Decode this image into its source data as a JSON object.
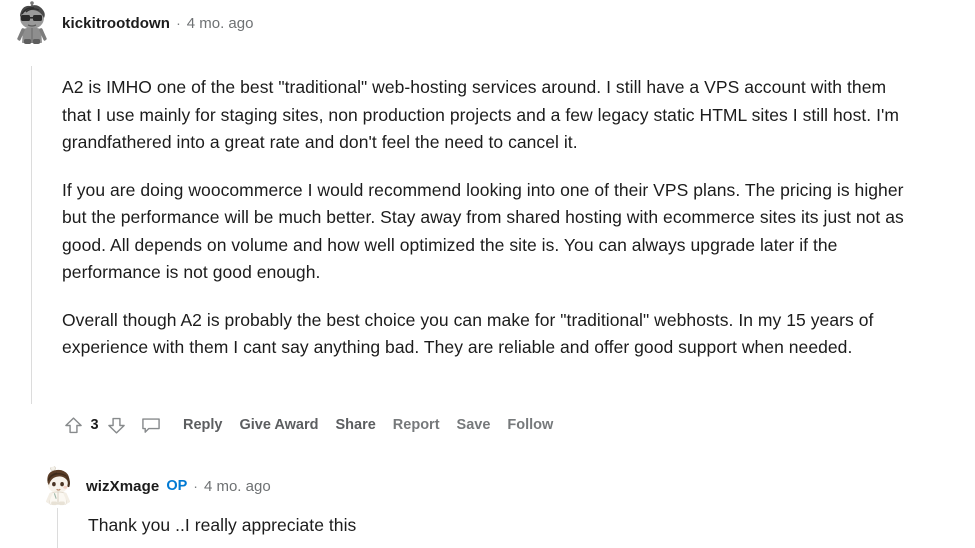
{
  "comments": [
    {
      "author": "kickitrootdown",
      "op": false,
      "separator": "·",
      "timestamp": "4 mo. ago",
      "avatar_name": "avatar-snoo-sunglasses",
      "paragraphs": [
        "A2 is IMHO one of the best \"traditional\" web-hosting services around. I still have a VPS account with them that I use mainly for staging sites, non production projects and a few legacy static HTML sites I still host. I'm grandfathered into a great rate and don't feel the need to cancel it.",
        "If you are doing woocommerce I would recommend looking into one of their VPS plans. The pricing is higher but the performance will be much better. Stay away from shared hosting with ecommerce sites its just not as good. All depends on volume and how well optimized the site is. You can always upgrade later if the performance is not good enough.",
        "Overall though A2 is probably the best choice you can make for \"traditional\" webhosts. In my 15 years of experience with them I cant say anything bad. They are reliable and offer good support when needed."
      ],
      "actions": {
        "upvote_icon": "upvote-arrow-icon",
        "score": "3",
        "downvote_icon": "downvote-arrow-icon",
        "comment_icon": "comment-bubble-icon",
        "reply_label": "Reply",
        "give_award_label": "Give Award",
        "share_label": "Share",
        "report_label": "Report",
        "save_label": "Save",
        "follow_label": "Follow"
      }
    },
    {
      "author": "wizXmage",
      "op": true,
      "op_label": "OP",
      "separator": "·",
      "timestamp": "4 mo. ago",
      "avatar_name": "avatar-snoo-brown-hair",
      "paragraphs": [
        "Thank you ..I really appreciate this"
      ]
    }
  ],
  "colors": {
    "text": "#1c1c1c",
    "meta": "#6e7173",
    "action": "#5c5e60",
    "op_blue": "#0079d3",
    "threadline": "#dcdcdc",
    "background": "#ffffff"
  }
}
